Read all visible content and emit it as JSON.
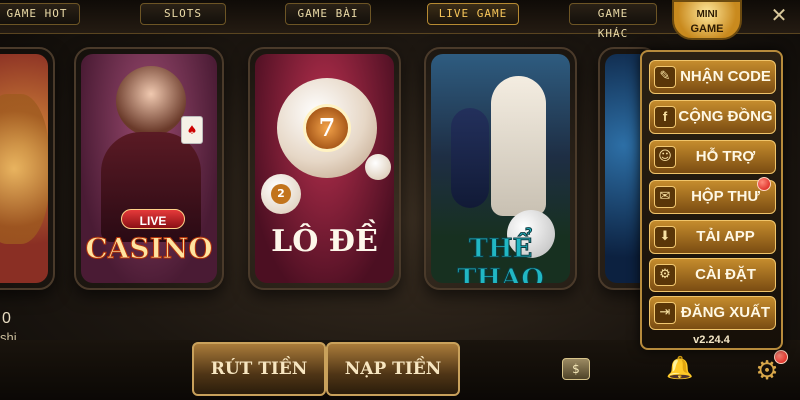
{
  "tabs": {
    "game_hot": "GAME HOT",
    "slots": "SLOTS",
    "game_bai": "GAME BÀI",
    "live_game": "LIVE GAME",
    "game_khac": "GAME KHÁC"
  },
  "mini_game": {
    "line1": "MINI",
    "line2": "GAME"
  },
  "cards": {
    "casino_badge": "LIVE",
    "casino_label": "CASINO",
    "lode_ball_number": "7",
    "lode_small_ball_number": "2",
    "lode_label": "LÔ ĐỀ",
    "thethao_label": "THỂ THAO"
  },
  "left_partial": {
    "value": "0",
    "label": "shi"
  },
  "bottom": {
    "withdraw": "RÚT TIỀN",
    "deposit": "NẠP TIỀN"
  },
  "menu": {
    "items": [
      {
        "label": "NHẬN CODE",
        "icon": "gift-code-icon"
      },
      {
        "label": "CỘNG ĐỒNG",
        "icon": "facebook-icon"
      },
      {
        "label": "HỖ TRỢ",
        "icon": "support-agent-icon"
      },
      {
        "label": "HỘP THƯ",
        "icon": "mail-icon"
      },
      {
        "label": "TẢI APP",
        "icon": "download-icon"
      },
      {
        "label": "CÀI ĐẶT",
        "icon": "gear-icon"
      },
      {
        "label": "ĐĂNG XUẤT",
        "icon": "logout-icon"
      }
    ],
    "version": "v2.24.4"
  },
  "colors": {
    "accent_gold": "#f7c65a",
    "notification_red": "#d4140f",
    "menu_button": "#c58c2d"
  }
}
